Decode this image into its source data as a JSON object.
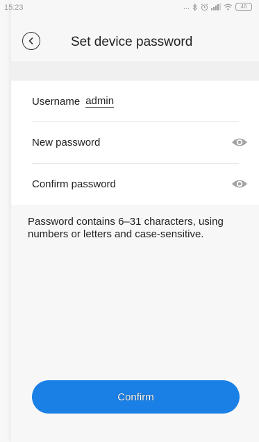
{
  "status_bar": {
    "time": "15:23",
    "icons": [
      "dots-icon",
      "bluetooth-icon",
      "alarm-icon",
      "signal-icon",
      "wifi-icon",
      "battery-icon"
    ],
    "dots": "...",
    "battery": "46"
  },
  "header": {
    "title": "Set device password",
    "back_icon": "chevron-left-icon"
  },
  "form": {
    "username_label": "Username",
    "username_value": "admin",
    "new_password_label": "New password",
    "new_password_value": "",
    "confirm_password_label": "Confirm password",
    "confirm_password_value": "",
    "eye_icon": "eye-icon"
  },
  "hint": "Password contains 6–31 characters, using numbers or letters and case-sensitive.",
  "confirm_button": {
    "label": "Confirm"
  },
  "colors": {
    "accent": "#1a80e6",
    "background": "#f7f7f7",
    "card": "#ffffff",
    "icon_gray": "#9e9e9e"
  }
}
